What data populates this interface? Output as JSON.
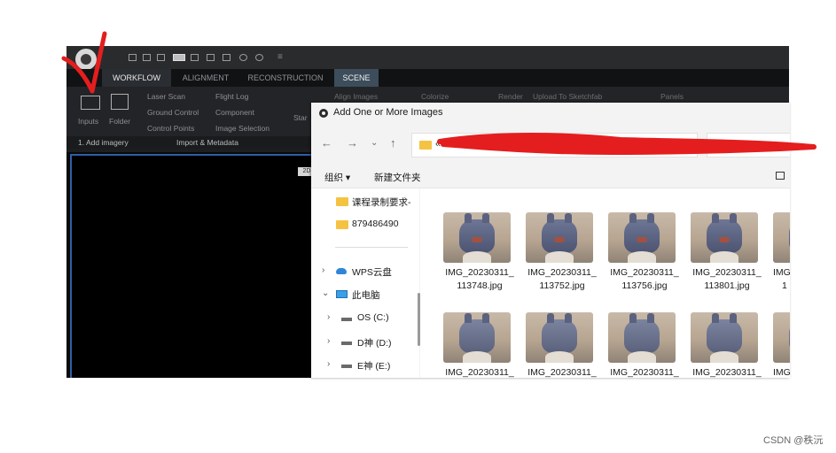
{
  "app": {
    "tabs": [
      "WORKFLOW",
      "ALIGNMENT",
      "RECONSTRUCTION",
      "SCENE"
    ],
    "ribbon": {
      "inputs_label": "Inputs",
      "folder_label": "Folder",
      "laser_scan": "Laser Scan",
      "ground_control": "Ground Control",
      "control_points": "Control Points",
      "flight_log": "Flight Log",
      "component": "Component",
      "image_selection": "Image Selection",
      "start": "Star",
      "align_images": "Align Images",
      "colorize": "Colorize",
      "render": "Render",
      "upload": "Upload To Sketchfab",
      "panels": "Panels",
      "group_add_imagery": "1. Add imagery",
      "group_import_metadata": "Import & Metadata"
    },
    "viewport_chip": "2D"
  },
  "dialog": {
    "title": "Add One or More Images",
    "address_prefix": "«",
    "organize": "组织 ▾",
    "new_folder": "新建文件夹",
    "sidebar": [
      {
        "label": "课程录制要求-",
        "icon": "folder-icon"
      },
      {
        "label": "879486490",
        "icon": "folder-icon"
      },
      {
        "label": "WPS云盘",
        "icon": "cloud-icon",
        "chevron": "›"
      },
      {
        "label": "此电脑",
        "icon": "computer-icon",
        "chevron": "⌄"
      },
      {
        "label": "OS (C:)",
        "icon": "drive-icon",
        "chevron": "›"
      },
      {
        "label": "D神 (D:)",
        "icon": "drive-icon",
        "chevron": "›"
      },
      {
        "label": "E神 (E:)",
        "icon": "drive-icon",
        "chevron": "›"
      }
    ],
    "files": [
      {
        "line1": "IMG_20230311_",
        "line2": "113748.jpg"
      },
      {
        "line1": "IMG_20230311_",
        "line2": "113752.jpg"
      },
      {
        "line1": "IMG_20230311_",
        "line2": "113756.jpg"
      },
      {
        "line1": "IMG_20230311_",
        "line2": "113801.jpg"
      },
      {
        "line1": "IMG",
        "line2": "1"
      },
      {
        "line1": "IMG_20230311_",
        "line2": ""
      },
      {
        "line1": "IMG_20230311_",
        "line2": ""
      },
      {
        "line1": "IMG_20230311_",
        "line2": ""
      },
      {
        "line1": "IMG_20230311_",
        "line2": ""
      },
      {
        "line1": "IMG",
        "line2": ""
      }
    ]
  },
  "watermark": "CSDN @秩沅",
  "colors": {
    "annotation_red": "#e41e1e",
    "dialog_bg": "#f3f3f3",
    "app_bg": "#1d1e20"
  }
}
